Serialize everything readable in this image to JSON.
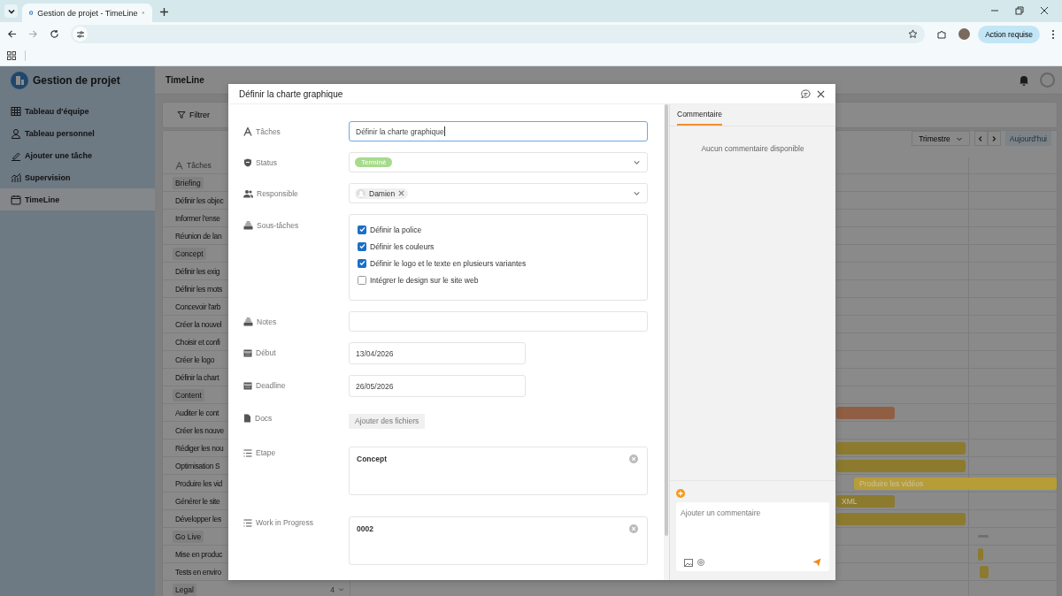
{
  "browser": {
    "tab_title": "Gestion de projet - TimeLine",
    "action_button": "Action requise"
  },
  "sidebar": {
    "app_title": "Gestion de projet",
    "items": [
      {
        "label": "Tableau d'équipe",
        "selected": false
      },
      {
        "label": "Tableau personnel",
        "selected": false
      },
      {
        "label": "Ajouter une tâche",
        "selected": false
      },
      {
        "label": "Supervision",
        "selected": false
      },
      {
        "label": "TimeLine",
        "selected": true
      }
    ]
  },
  "header": {
    "title": "TimeLine"
  },
  "toolbar": {
    "filter": "Filtrer"
  },
  "gantt_controls": {
    "scale": "Trimestre",
    "today": "Aujourd'hui"
  },
  "task_list": {
    "header": "Tâches",
    "rows": [
      {
        "kind": "group",
        "label": "Briefing"
      },
      {
        "kind": "task",
        "label": "Définir les objec"
      },
      {
        "kind": "task",
        "label": "Informer l'ense"
      },
      {
        "kind": "task",
        "label": "Réunion de lan"
      },
      {
        "kind": "group",
        "label": "Concept"
      },
      {
        "kind": "task",
        "label": "Définir les exig"
      },
      {
        "kind": "task",
        "label": "Définir les mots"
      },
      {
        "kind": "task",
        "label": "Concevoir l'arb"
      },
      {
        "kind": "task",
        "label": "Créer la nouvel"
      },
      {
        "kind": "task",
        "label": "Choisir et confi"
      },
      {
        "kind": "task",
        "label": "Créer le logo"
      },
      {
        "kind": "task",
        "label": "Définir la chart"
      },
      {
        "kind": "group",
        "label": "Content"
      },
      {
        "kind": "task",
        "label": "Auditer le cont",
        "bar": {
          "color": "#8f5e43"
        }
      },
      {
        "kind": "task",
        "label": "Créer les nouve"
      },
      {
        "kind": "task",
        "label": "Rédiger les nou",
        "bar": {
          "color": "#8c7a2e"
        }
      },
      {
        "kind": "task",
        "label": "Optimisation S",
        "bar": {
          "color": "#8c7a2e"
        }
      },
      {
        "kind": "task",
        "label": "Produire les vid",
        "bar": {
          "color": "#b79d38",
          "label": "Produire les vidéos"
        }
      },
      {
        "kind": "task",
        "label": "Générer le site",
        "bar": {
          "color": "#8c7a2e",
          "label": "XML"
        }
      },
      {
        "kind": "task",
        "label": "Développer les",
        "bar": {
          "color": "#8c7a2e"
        }
      },
      {
        "kind": "group",
        "label": "Go Live",
        "bar": {
          "color": "#707070"
        }
      },
      {
        "kind": "task",
        "label": "Mise en produc",
        "bar": {
          "color": "#8c7a2e"
        }
      },
      {
        "kind": "task",
        "label": "Tests en enviro",
        "bar": {
          "color": "#8c7a2e"
        }
      },
      {
        "kind": "group",
        "label": "Legal",
        "count": "4"
      }
    ]
  },
  "modal": {
    "title": "Définir la charte graphique",
    "fields": [
      {
        "kind": "text",
        "label": "Tâches",
        "value": "Définir la charte graphique",
        "focused": true
      },
      {
        "kind": "status",
        "label": "Status",
        "value": "Terminé"
      },
      {
        "kind": "people",
        "label": "Responsible",
        "chips": [
          "Damien"
        ]
      },
      {
        "kind": "checklist",
        "label": "Sous-tâches",
        "items": [
          {
            "label": "Définir la police",
            "checked": true
          },
          {
            "label": "Définir les couleurs",
            "checked": true
          },
          {
            "label": "Définir le logo et le texte en plusieurs variantes",
            "checked": true
          },
          {
            "label": "Intégrer le design sur le site web",
            "checked": false
          }
        ]
      },
      {
        "kind": "text",
        "label": "Notes",
        "focused": false
      },
      {
        "kind": "date",
        "label": "Début",
        "value": "13/04/2026"
      },
      {
        "kind": "date",
        "label": "Deadline",
        "value": "26/05/2026"
      },
      {
        "kind": "files",
        "label": "Docs",
        "button": "Ajouter des fichiers"
      },
      {
        "kind": "tag",
        "label": "Etape",
        "value": "Concept"
      },
      {
        "kind": "tag",
        "label": "Work in Progress",
        "value": "0002"
      }
    ]
  },
  "comments": {
    "tab": "Commentaire",
    "empty": "Aucun commentaire disponible",
    "placeholder": "Ajouter un commentaire"
  }
}
